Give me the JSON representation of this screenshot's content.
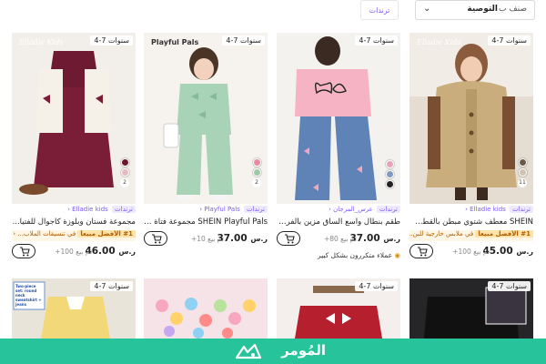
{
  "topbar": {
    "sort_label": "صنف ب",
    "sort_value": "التوصية",
    "trend_tab": "ترندات"
  },
  "products": [
    {
      "age": "4-7 سنوات",
      "brand_logo": "Elladie Kids",
      "trend_tag": "ترندات",
      "store": "Elladie kids",
      "title": "SHEIN معطف شتوي مبطن بالقطن ل...",
      "best_tag": "#1 الأفضل مبيعاً",
      "best_category": "في ملابس خارجية للبن...",
      "price": "45.00",
      "currency": "ر.س",
      "sold": "تم بيع 100+",
      "swatch_more": "11",
      "swatch_colors": [
        "#6b5a48",
        "#cfc3b0"
      ]
    },
    {
      "age": "4-7 سنوات",
      "trend_tag": "ترندات",
      "store": "عرس_المرجان",
      "title": "طقم بنطال واسع الساق مزين بالفراش...",
      "price": "37.00",
      "currency": "ر.س",
      "sold": "تم بيع 80+",
      "note": "عملاء متكررون بشكل كبير",
      "swatch_colors": [
        "#e8a3b8",
        "#7f9bc5",
        "#222222"
      ]
    },
    {
      "age": "4-7 سنوات",
      "brand_logo": "Playful Pals",
      "trend_tag": "ترندات",
      "store": "Playful Pals",
      "title": "SHEIN Playful Pals مجموعة فتاة شي...",
      "price": "37.00",
      "currency": "ر.س",
      "sold": "تم بيع 10+",
      "swatch_more": "2",
      "swatch_colors": [
        "#e88aa3",
        "#9ec8a8"
      ]
    },
    {
      "age": "4-7 سنوات",
      "brand_logo": "Elladie Kids",
      "trend_tag": "ترندات",
      "store": "Elladie kids",
      "title": "مجموعة فستان وبلوزة كاجوال للفتيا...",
      "best_tag": "#1 الأفضل مبيعاً",
      "best_category": "في تنسيقات الملاب...",
      "price": "46.00",
      "currency": "ر.س",
      "sold": "تم بيع 100+",
      "swatch_more": "2",
      "swatch_colors": [
        "#6b1730",
        "#e8b8c5"
      ]
    }
  ],
  "row2": [
    {
      "age": "4-7 سنوات"
    },
    {
      "age": "4-7 سنوات"
    },
    {
      "age": ""
    },
    {
      "age": "4-7 سنوات",
      "overlay": "Two-piece set: round neck sweatshirt + jeans"
    }
  ],
  "footer": {
    "brand": "المُومر",
    "color": "#27c39a"
  }
}
